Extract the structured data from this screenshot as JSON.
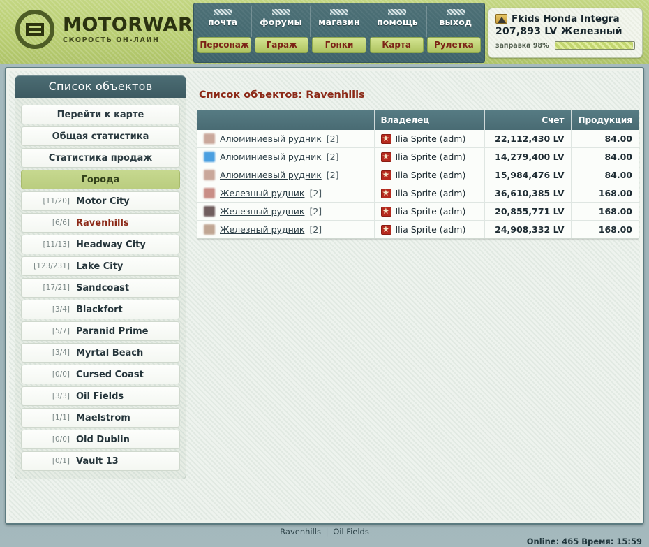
{
  "brand": {
    "title": "MOTORWARS.RU",
    "tagline": "СКОРОСТЬ ОН-ЛАЙН",
    "logo_icon": "crosshair-logo-icon"
  },
  "nav": {
    "top_items": [
      {
        "label": "почта",
        "icon": "mail-icon"
      },
      {
        "label": "форумы",
        "icon": "forum-icon"
      },
      {
        "label": "магазин",
        "icon": "shop-icon"
      },
      {
        "label": "помощь",
        "icon": "help-icon"
      },
      {
        "label": "выход",
        "icon": "logout-icon"
      }
    ],
    "buttons": [
      {
        "label": "Персонаж"
      },
      {
        "label": "Гараж"
      },
      {
        "label": "Гонки"
      },
      {
        "label": "Карта"
      },
      {
        "label": "Рулетка"
      }
    ]
  },
  "user": {
    "icon": "car-avatar-icon",
    "name": "Fkids Honda Integra",
    "money": "207,893 LV Железный",
    "fuel_label": "заправка 98%",
    "fuel_percent": 98
  },
  "sidebar": {
    "header": "Список объектов",
    "buttons": [
      {
        "label": "Перейти к карте",
        "active": false
      },
      {
        "label": "Общая статистика",
        "active": false
      },
      {
        "label": "Статистика продаж",
        "active": false
      },
      {
        "label": "Города",
        "active": true
      }
    ],
    "cities": [
      {
        "count": "[11/20]",
        "name": "Motor City",
        "current": false
      },
      {
        "count": "[6/6]",
        "name": "Ravenhills",
        "current": true
      },
      {
        "count": "[11/13]",
        "name": "Headway City",
        "current": false
      },
      {
        "count": "[123/231]",
        "name": "Lake City",
        "current": false
      },
      {
        "count": "[17/21]",
        "name": "Sandcoast",
        "current": false
      },
      {
        "count": "[3/4]",
        "name": "Blackfort",
        "current": false
      },
      {
        "count": "[5/7]",
        "name": "Paranid Prime",
        "current": false
      },
      {
        "count": "[3/4]",
        "name": "Myrtal Beach",
        "current": false
      },
      {
        "count": "[0/0]",
        "name": "Cursed Coast",
        "current": false
      },
      {
        "count": "[3/3]",
        "name": "Oil Fields",
        "current": false
      },
      {
        "count": "[1/1]",
        "name": "Maelstrom",
        "current": false
      },
      {
        "count": "[0/0]",
        "name": "Old Dublin",
        "current": false
      },
      {
        "count": "[0/1]",
        "name": "Vault 13",
        "current": false
      }
    ]
  },
  "content": {
    "title": "Список объектов: Ravenhills",
    "table": {
      "headers": [
        "",
        "Владелец",
        "Счет",
        "Продукция"
      ],
      "rows": [
        {
          "thumb": "#caa89b",
          "name": "Алюминиевый рудник",
          "qty": "[2]",
          "owner": "Ilia Sprite (adm)",
          "owner_badge": "red-star-icon",
          "account": "22,112,430 LV",
          "production": "84.00"
        },
        {
          "thumb": "#4a9fe0",
          "name": "Алюминиевый рудник",
          "qty": "[2]",
          "owner": "Ilia Sprite (adm)",
          "owner_badge": "red-star-icon",
          "account": "14,279,400 LV",
          "production": "84.00"
        },
        {
          "thumb": "#c9a79a",
          "name": "Алюминиевый рудник",
          "qty": "[2]",
          "owner": "Ilia Sprite (adm)",
          "owner_badge": "red-star-icon",
          "account": "15,984,476 LV",
          "production": "84.00"
        },
        {
          "thumb": "#c98e86",
          "name": "Железный рудник",
          "qty": "[2]",
          "owner": "Ilia Sprite (adm)",
          "owner_badge": "red-star-icon",
          "account": "36,610,385 LV",
          "production": "168.00"
        },
        {
          "thumb": "#705e5e",
          "name": "Железный рудник",
          "qty": "[2]",
          "owner": "Ilia Sprite (adm)",
          "owner_badge": "red-star-icon",
          "account": "20,855,771 LV",
          "production": "168.00"
        },
        {
          "thumb": "#c0a693",
          "name": "Железный рудник",
          "qty": "[2]",
          "owner": "Ilia Sprite (adm)",
          "owner_badge": "red-star-icon",
          "account": "24,908,332 LV",
          "production": "168.00"
        }
      ]
    }
  },
  "footer": {
    "links": [
      "Ravenhills",
      "Oil Fields"
    ],
    "separator": "|",
    "status": "Online: 465  Время: 15:59"
  }
}
